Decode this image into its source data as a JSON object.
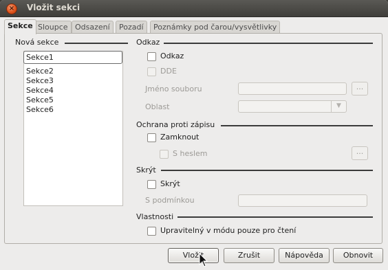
{
  "window": {
    "title": "Vložit sekci",
    "close_icon_glyph": "×"
  },
  "tabs": [
    {
      "label": "Sekce",
      "active": true
    },
    {
      "label": "Sloupce",
      "active": false
    },
    {
      "label": "Odsazení",
      "active": false
    },
    {
      "label": "Pozadí",
      "active": false
    },
    {
      "label": "Poznámky pod čarou/vysvětlivky",
      "active": false
    }
  ],
  "new_section": {
    "title": "Nová sekce",
    "input_value": "Sekce1",
    "items": [
      "Sekce2",
      "Sekce3",
      "Sekce4",
      "Sekce5",
      "Sekce6"
    ]
  },
  "link": {
    "title": "Odkaz",
    "link_checkbox": "Odkaz",
    "dde_checkbox": "DDE",
    "filename_label": "Jméno souboru",
    "filename_value": "",
    "browse_label": "...",
    "area_label": "Oblast",
    "area_value": ""
  },
  "protection": {
    "title": "Ochrana proti zápisu",
    "lock_checkbox": "Zamknout",
    "password_checkbox": "S heslem",
    "password_button": "..."
  },
  "hide": {
    "title": "Skrýt",
    "hide_checkbox": "Skrýt",
    "condition_label": "S podmínkou",
    "condition_value": ""
  },
  "properties": {
    "title": "Vlastnosti",
    "editable_checkbox": "Upravitelný v módu pouze pro čtení"
  },
  "buttons": {
    "insert": "Vložit",
    "cancel": "Zrušit",
    "help": "Nápověda",
    "reset": "Obnovit"
  },
  "colors": {
    "titlebar": "#4a4945",
    "close": "#e0541c",
    "background": "#edeceb"
  }
}
